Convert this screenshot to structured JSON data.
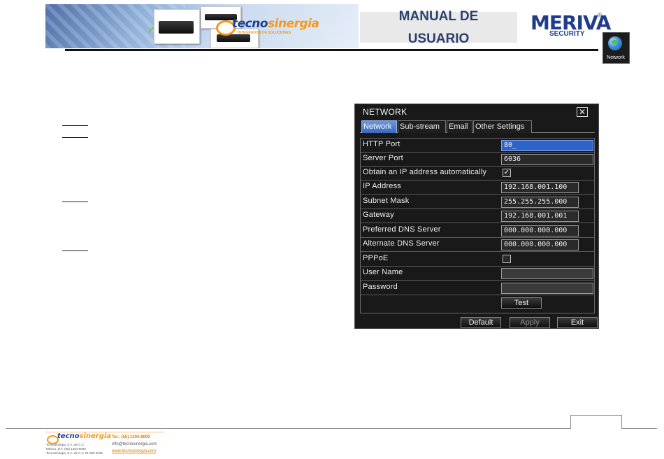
{
  "header": {
    "banner_brand_main": "tecno",
    "banner_brand_accent": "sinergia",
    "banner_brand_tagline": "INTEGRADOR DE SOLUCIONES",
    "manual_title_line1": "MANUAL DE",
    "manual_title_line2": "USUARIO",
    "meriva_logo": "MERIVA",
    "meriva_registered": "®",
    "meriva_sub": "SECURITY",
    "network_icon_label": "Network"
  },
  "network_dialog": {
    "title": "NETWORK",
    "close_glyph": "✕",
    "tabs": [
      {
        "label": "Network",
        "active": true
      },
      {
        "label": "Sub-stream",
        "active": false
      },
      {
        "label": "Email",
        "active": false
      },
      {
        "label": "Other Settings",
        "active": false
      }
    ],
    "rows": [
      {
        "label": "HTTP Port",
        "value": "80_"
      },
      {
        "label": "Server Port",
        "value": "6036"
      },
      {
        "label": "Obtain an IP address automatically",
        "checked": true,
        "check_glyph": "✓"
      },
      {
        "label": "IP Address",
        "value": "192.168.001.100"
      },
      {
        "label": "Subnet Mask",
        "value": "255.255.255.000"
      },
      {
        "label": "Gateway",
        "value": "192.168.001.001"
      },
      {
        "label": "Preferred DNS Server",
        "value": "000.000.000.000"
      },
      {
        "label": "Alternate DNS Server",
        "value": "000.000.000.000"
      },
      {
        "label": "PPPoE",
        "checked": false
      },
      {
        "label": "User Name",
        "value": ""
      },
      {
        "label": "Password",
        "value": ""
      }
    ],
    "test_label": "Test",
    "buttons": {
      "default": "Default",
      "apply": "Apply",
      "exit": "Exit"
    }
  },
  "footer": {
    "brand_main": "tecno",
    "brand_accent": "sinergia",
    "small_line1": "Tecnosinergia, S.A. de C.V.",
    "small_line2": "México, D.F. (55) 1204-8000",
    "small_line3": "Tecnosinergia, S.A. de C.V. 01 800 8335",
    "phone": "Tel.: (55) 1204-8000",
    "email": "info@tecnosinergia.com",
    "website": "www.tecnosinergia.com"
  },
  "colors": {
    "dialog_bg": "#191919",
    "tab_active": "#3a68bd",
    "focused_field": "#2f63c8",
    "brand_blue": "#1b3f8f",
    "brand_orange": "#f29a1f"
  }
}
